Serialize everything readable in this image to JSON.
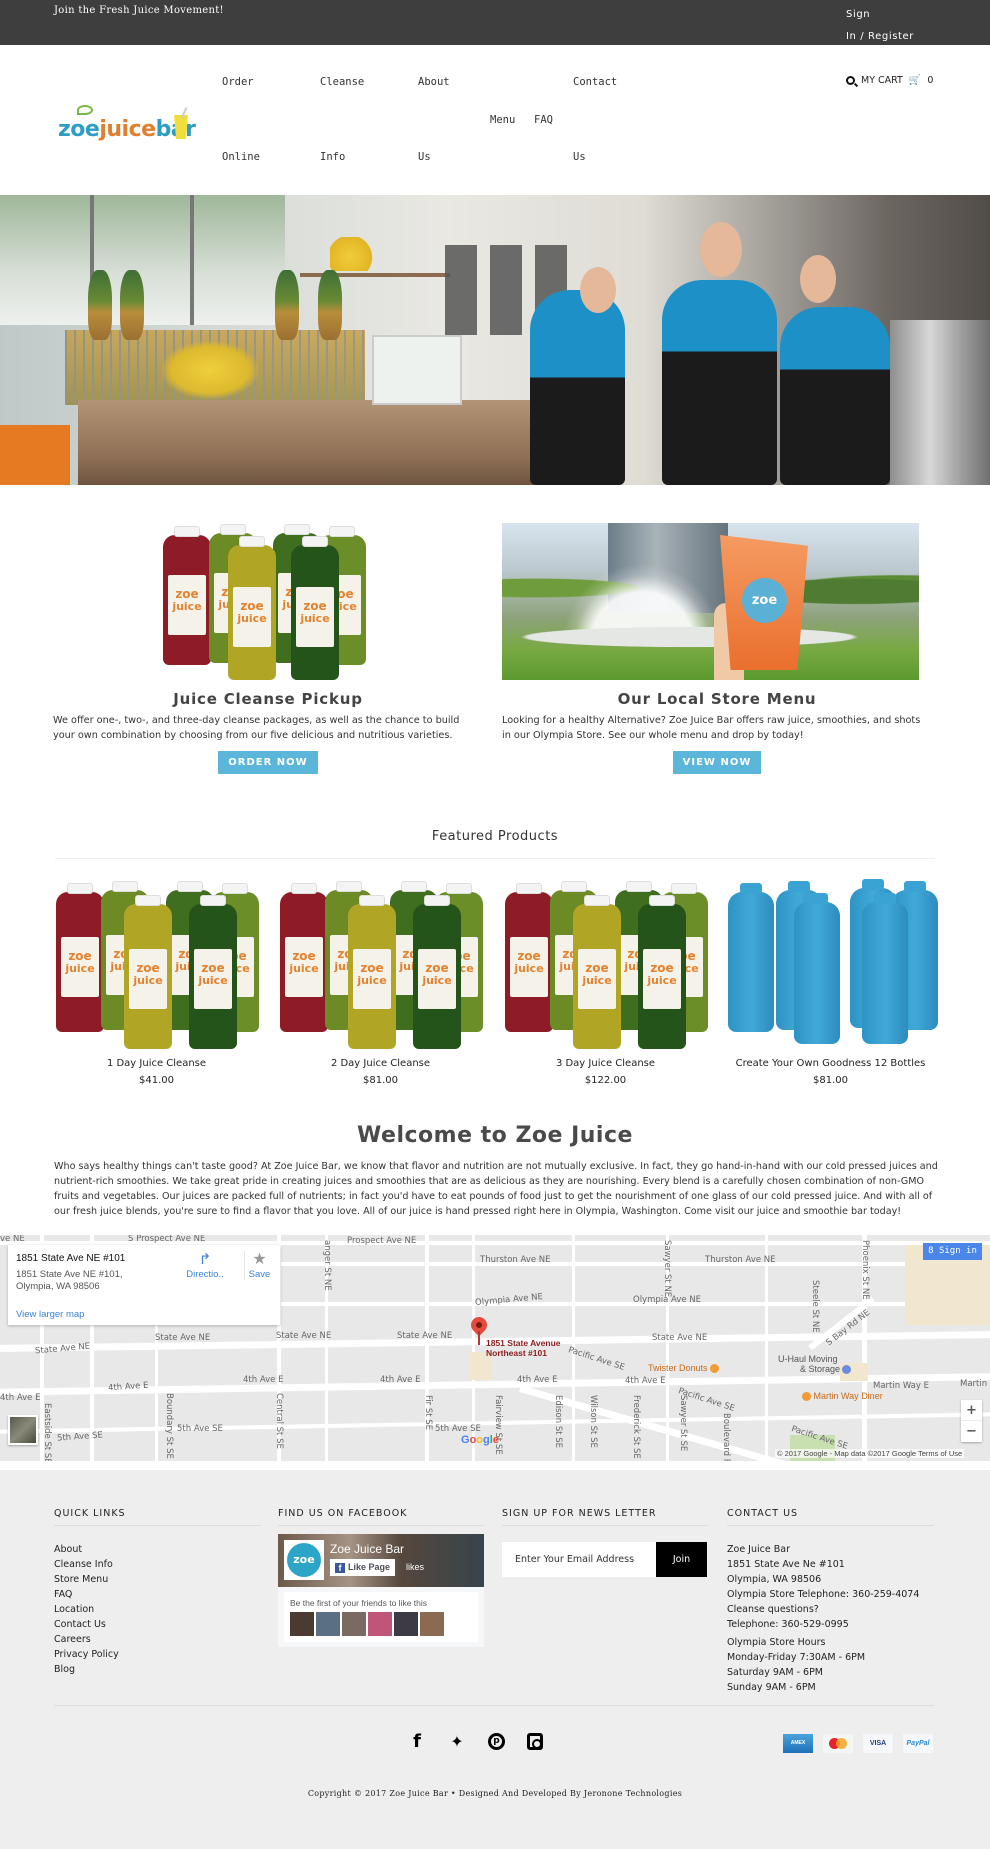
{
  "topbar": {
    "tagline": "Join the Fresh Juice Movement!",
    "signin_line1": "Sign",
    "signin_line2": "In / Register"
  },
  "header": {
    "logo": {
      "zoe": "zoe",
      "juice": "juice",
      "bar": "bar"
    },
    "nav": [
      {
        "line1": "Order",
        "line2": "Online"
      },
      {
        "line1": "Cleanse",
        "line2": "Info"
      },
      {
        "line1": "About",
        "line2": "Us"
      },
      {
        "line1": "Menu"
      },
      {
        "line1": "FAQ"
      },
      {
        "line1": "Contact",
        "line2": "Us"
      }
    ],
    "cart": {
      "label": "MY CART",
      "count": "0",
      "search_icon": "search-icon",
      "cart_icon": "cart-icon"
    }
  },
  "promos": [
    {
      "title": "Juice Cleanse Pickup",
      "text": "We offer one-, two-, and three-day cleanse packages, as well as the chance to build your own combination by choosing from our five delicious and nutritious varieties.",
      "button": "ORDER NOW"
    },
    {
      "title": "Our Local Store Menu",
      "text": "Looking for a healthy Alternative? Zoe Juice Bar offers raw juice, smoothies, and shots in our Olympia Store. See our whole menu and drop by today!",
      "button": "VIEW NOW",
      "cup_logo": "zoe"
    }
  ],
  "featured": {
    "title": "Featured Products",
    "products": [
      {
        "name": "1 Day Juice Cleanse",
        "price": "$41.00"
      },
      {
        "name": "2 Day Juice Cleanse",
        "price": "$81.00"
      },
      {
        "name": "3 Day Juice Cleanse",
        "price": "$122.00"
      },
      {
        "name": "Create Your Own Goodness 12 Bottles",
        "price": "$81.00"
      }
    ]
  },
  "welcome": {
    "title": "Welcome to Zoe Juice",
    "text": "Who says healthy things can't taste good? At Zoe Juice Bar, we know that flavor and nutrition are not mutually exclusive. In fact, they go hand-in-hand with our cold pressed juices and nutrient-rich smoothies. We take great pride in creating juices and smoothies that are as delicious as they are nourishing. Every blend is a carefully chosen combination of non-GMO fruits and vegetables. Our juices are packed full of nutrients; in fact you'd have to eat pounds of food just to get the nourishment of one glass of our cold pressed juice. And with all of our fresh juice blends, you're sure to find a flavor that you love. All of our juice is hand pressed right here in Olympia, Washington. Come visit our juice and smoothie bar today!"
  },
  "map": {
    "card": {
      "title": "1851 State Ave NE #101",
      "address_line1": "1851 State Ave NE #101,",
      "address_line2": "Olympia, WA 98506",
      "view_larger": "View larger map",
      "directions": "Directio..",
      "save": "Save"
    },
    "pin_label_line1": "1851 State Avenue",
    "pin_label_line2": "Northeast #101",
    "sign_in": "Sign in",
    "zoom_in": "+",
    "zoom_out": "−",
    "footer": "© 2017 Google - Map data ©2017 Google   Terms of Use",
    "google": "Google",
    "street_labels": {
      "prospect1": "S Prospect Ave NE",
      "prospect2": "Prospect Ave NE",
      "thurston1": "Thurston Ave NE",
      "thurston2": "Thurston Ave NE",
      "olympia1": "Olympia Ave NE",
      "olympia2": "Olympia Ave NE",
      "state1": "State Ave NE",
      "state2": "State Ave NE",
      "state3": "State Ave NE",
      "state4": "State Ave NE",
      "state5": "State Ave NE",
      "fourth1": "4th Ave E",
      "fourth2": "4th Ave E",
      "fourth3": "4th Ave E",
      "fourth4": "4th Ave E",
      "fourth5": "4th Ave E",
      "fourth6": "4th Ave E",
      "fifth1": "5th Ave SE",
      "fifth2": "5th Ave SE",
      "fifth3": "5th Ave SE",
      "pacific1": "Pacific Ave SE",
      "pacific2": "Pacific Ave SE",
      "pacific3": "Pacific Ave SE",
      "martin1": "Martin Way E",
      "martin2": "Martin Way E",
      "sbay": "S Bay Rd NE",
      "eastside": "Eastside St SE",
      "boundary": "Boundary St SE",
      "central": "Central St SE",
      "fir": "Fir St SE",
      "fairview": "Fairview St SE",
      "edison": "Edison St SE",
      "wilson": "Wilson St SE",
      "frederick": "Frederick St SE",
      "sawyer1": "Sawyer St NE",
      "sawyer2": "Sawyer St SE",
      "boulevard": "Boulevard Rd",
      "steele": "Steele St NE",
      "phoenix": "Phoenix St NE",
      "anger": "anger St NE",
      "vene": "ve NE"
    },
    "pois": [
      {
        "name": "Twister Donuts"
      },
      {
        "name": "U-Haul Moving"
      },
      {
        "name": "& Storage"
      },
      {
        "name": "Martin Way Diner"
      }
    ]
  },
  "footer": {
    "quick_links": {
      "title": "QUICK LINKS",
      "items": [
        "About",
        "Cleanse Info",
        "Store Menu",
        "FAQ",
        "Location",
        "Contact Us",
        "Careers",
        "Privacy Policy",
        "Blog"
      ]
    },
    "facebook": {
      "title": "FIND US ON FACEBOOK",
      "page_name": "Zoe Juice Bar",
      "avatar": "zoe",
      "like_button": "Like Page",
      "likes": "likes",
      "friends_text": "Be the first of your friends to like this"
    },
    "newsletter": {
      "title": "SIGN UP FOR NEWS LETTER",
      "placeholder": "Enter Your Email Address",
      "value": "",
      "button": "Join"
    },
    "contact": {
      "title": "CONTACT US",
      "lines": [
        "Zoe Juice Bar",
        "1851 State Ave Ne #101",
        "Olympia, WA 98506",
        "Olympia Store Telephone: 360-259-4074",
        "Cleanse questions?",
        "Telephone: 360-529-0995"
      ],
      "hours_title": "Olympia Store Hours",
      "hours": [
        "Monday-Friday 7:30AM - 6PM",
        "Saturday 9AM - 6PM",
        "Sunday 9AM - 6PM"
      ]
    },
    "social": [
      "facebook-icon",
      "twitter-icon",
      "pinterest-icon",
      "instagram-icon"
    ],
    "payments": {
      "amex": "AMEX",
      "visa": "VISA",
      "paypal": "PayPal"
    },
    "copyright": "Copyright © 2017 Zoe Juice Bar • Designed And Developed By Jeronone Technologies"
  },
  "colors": {
    "topbar_bg": "#3e3e3e",
    "button_blue": "#5bb6d9",
    "footer_bg": "#eeeeee",
    "logo_blue": "#2e9dc4",
    "logo_orange": "#e07f2e"
  }
}
